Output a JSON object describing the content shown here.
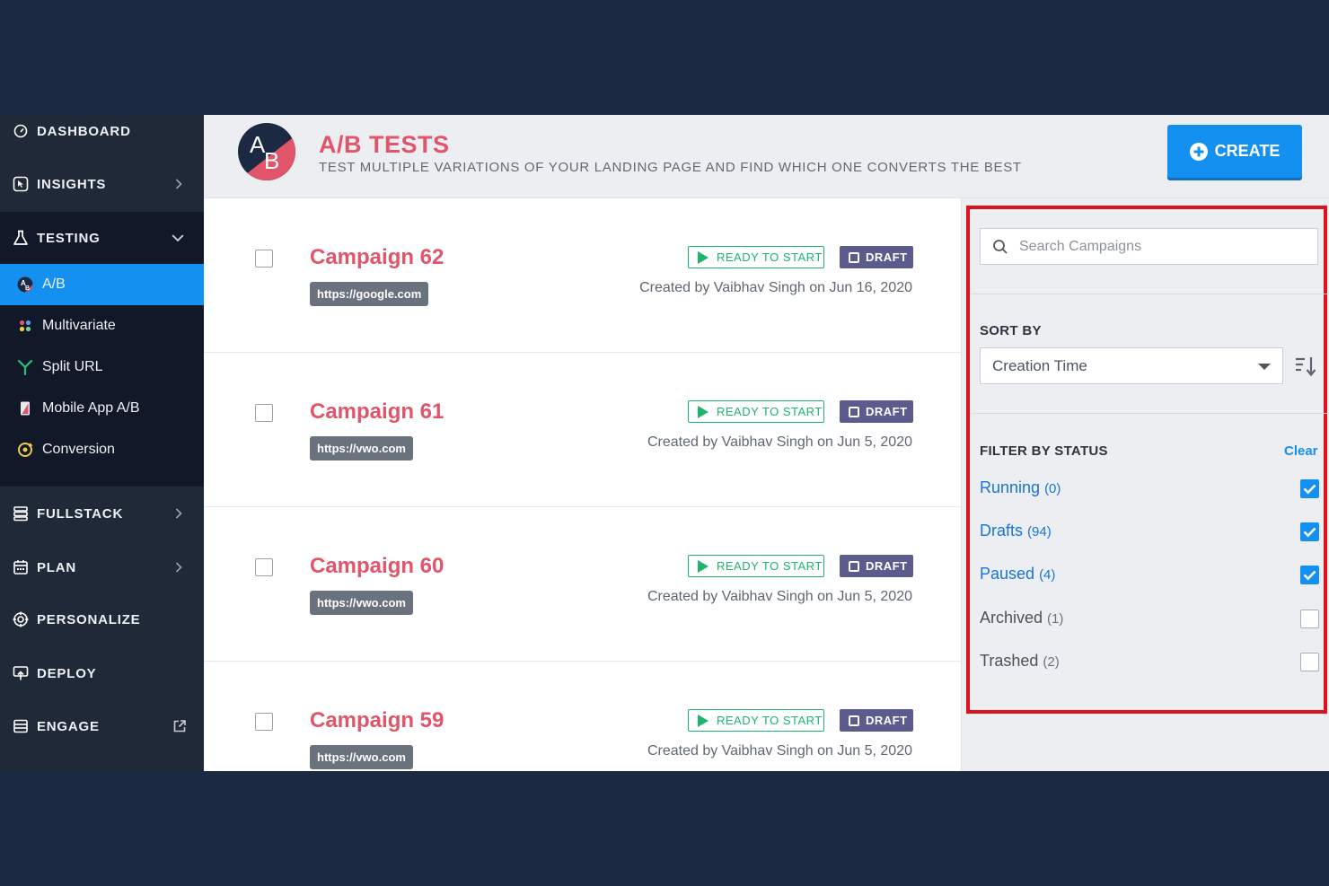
{
  "sidebar": {
    "dashboard": "DASHBOARD",
    "insights": "INSIGHTS",
    "testing": "TESTING",
    "testing_items": [
      {
        "label": "A/B",
        "active": true
      },
      {
        "label": "Multivariate",
        "active": false
      },
      {
        "label": "Split URL",
        "active": false
      },
      {
        "label": "Mobile App A/B",
        "active": false
      },
      {
        "label": "Conversion",
        "active": false
      }
    ],
    "fullstack": "FULLSTACK",
    "plan": "PLAN",
    "personalize": "PERSONALIZE",
    "deploy": "DEPLOY",
    "engage": "ENGAGE"
  },
  "header": {
    "logo_a": "A",
    "logo_b": "B",
    "title": "A/B TESTS",
    "subtitle": "TEST MULTIPLE VARIATIONS OF YOUR LANDING PAGE AND FIND WHICH ONE CONVERTS THE BEST",
    "create_label": "CREATE"
  },
  "campaigns": [
    {
      "name": "Campaign 62",
      "url": "https://google.com",
      "status": "READY TO START",
      "state": "DRAFT",
      "created": "Created by Vaibhav Singh on Jun 16, 2020"
    },
    {
      "name": "Campaign 61",
      "url": "https://vwo.com",
      "status": "READY TO START",
      "state": "DRAFT",
      "created": "Created by Vaibhav Singh on Jun 5, 2020"
    },
    {
      "name": "Campaign 60",
      "url": "https://vwo.com",
      "status": "READY TO START",
      "state": "DRAFT",
      "created": "Created by Vaibhav Singh on Jun 5, 2020"
    },
    {
      "name": "Campaign 59",
      "url": "https://vwo.com",
      "status": "READY TO START",
      "state": "DRAFT",
      "created": "Created by Vaibhav Singh on Jun 5, 2020"
    }
  ],
  "panel": {
    "search_placeholder": "Search Campaigns",
    "sort_label": "SORT BY",
    "sort_value": "Creation Time",
    "filter_label": "FILTER BY STATUS",
    "clear_label": "Clear",
    "statuses": [
      {
        "label": "Running",
        "count": "(0)",
        "checked": true
      },
      {
        "label": "Drafts",
        "count": "(94)",
        "checked": true
      },
      {
        "label": "Paused",
        "count": "(4)",
        "checked": true
      },
      {
        "label": "Archived",
        "count": "(1)",
        "checked": false
      },
      {
        "label": "Trashed",
        "count": "(2)",
        "checked": false
      }
    ]
  },
  "colors": {
    "accent": "#1491f0",
    "campaign_name": "#e0556a",
    "ready": "#1cb56b",
    "draft": "#5c5b8d",
    "highlight_border": "#e0111e"
  }
}
